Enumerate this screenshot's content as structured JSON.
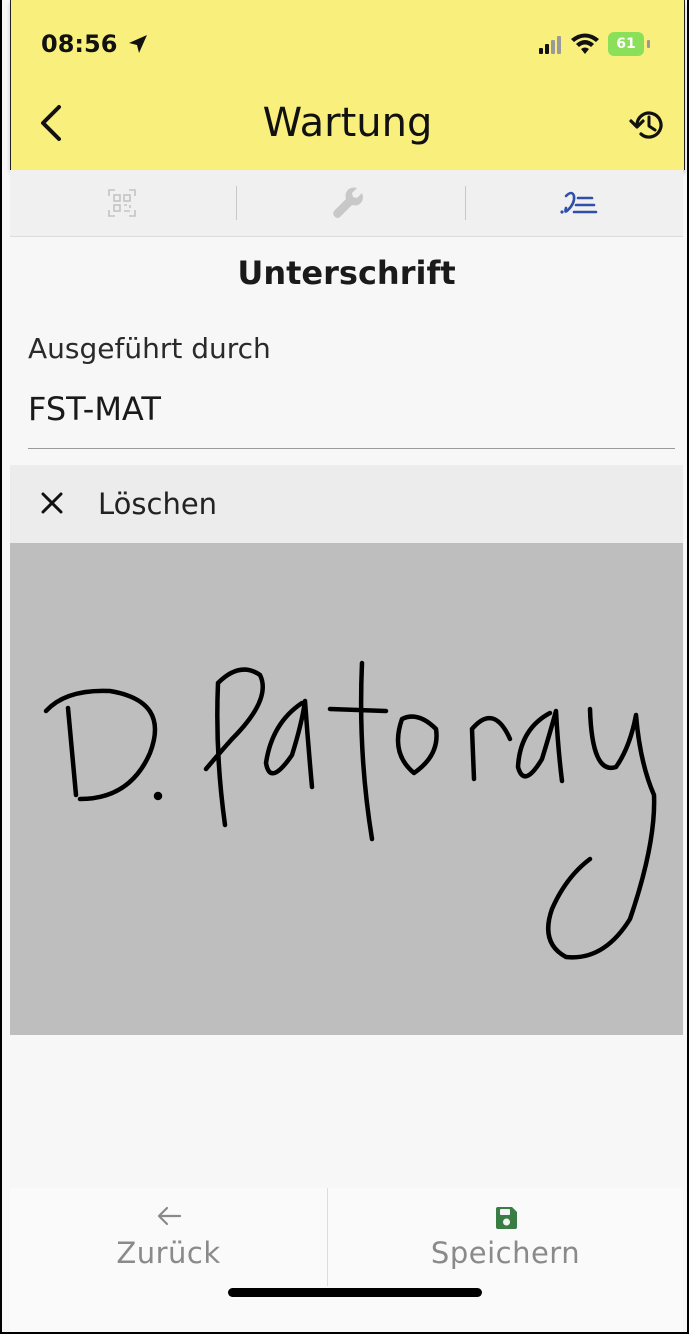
{
  "status_bar": {
    "time": "08:56",
    "battery": "61"
  },
  "header": {
    "title": "Wartung"
  },
  "tabs": [
    {
      "icon": "qr-code-icon",
      "active": false
    },
    {
      "icon": "wrench-icon",
      "active": false
    },
    {
      "icon": "signature-icon",
      "active": true
    }
  ],
  "colors": {
    "header_bg": "#f9ef7c",
    "accent_blue": "#2f4fa8",
    "save_green": "#3a7d44",
    "pad_gray": "#bebebe"
  },
  "section": {
    "title": "Unterschrift"
  },
  "form": {
    "executed_by_label": "Ausgeführt durch",
    "executed_by_value": "FST-MAT"
  },
  "signature_pad": {
    "clear_label": "Löschen"
  },
  "footer": {
    "back_label": "Zurück",
    "save_label": "Speichern"
  }
}
